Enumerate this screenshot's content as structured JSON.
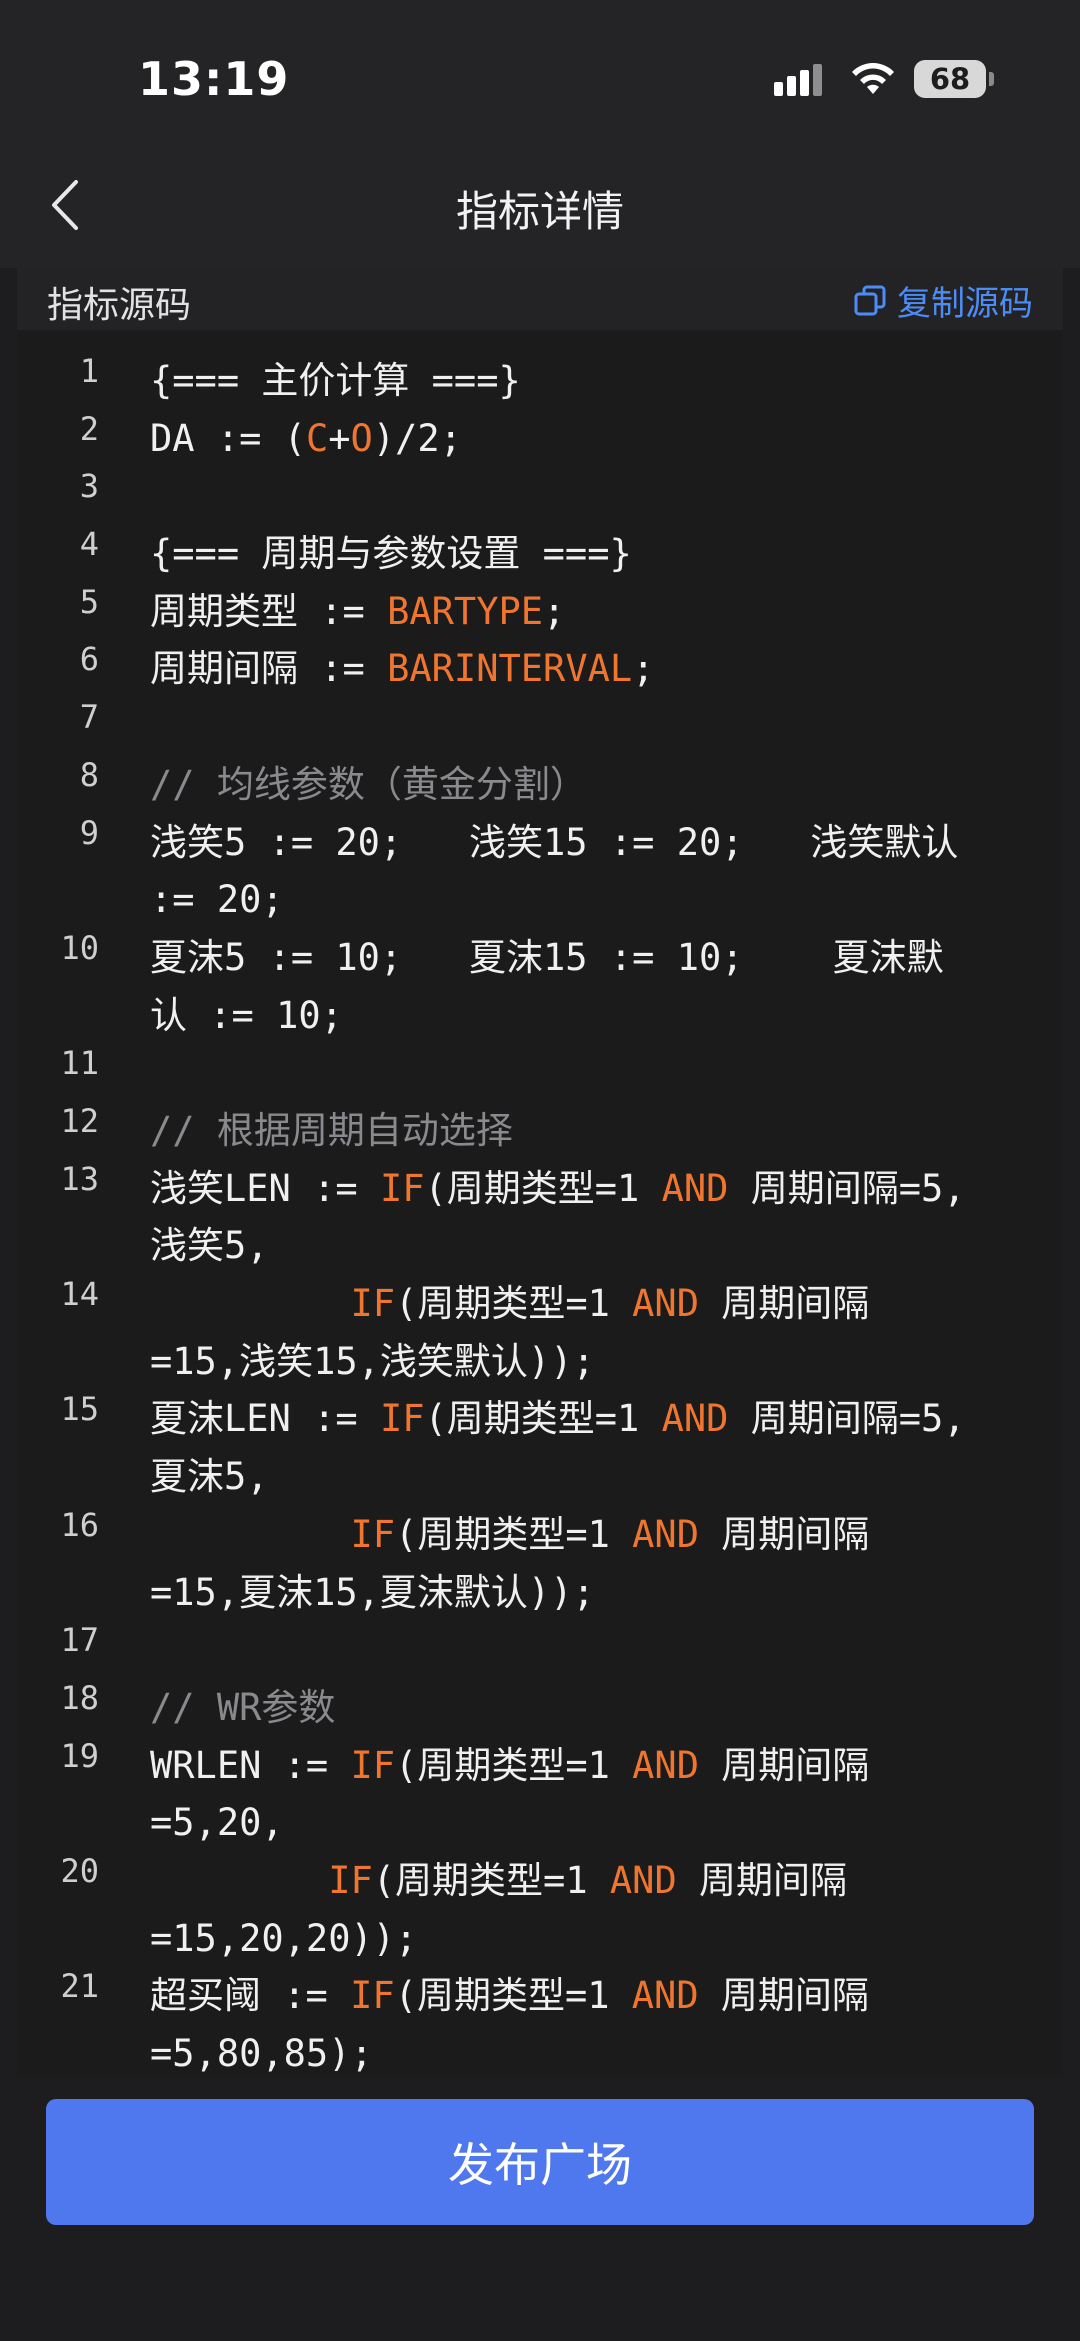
{
  "status_bar": {
    "time": "13:19",
    "battery": "68"
  },
  "header": {
    "title": "指标详情"
  },
  "card": {
    "title": "指标源码",
    "copy_label": "复制源码"
  },
  "code": [
    {
      "n": "1",
      "rows": 1,
      "parts": [
        {
          "t": "{=== 主价计算 ===}",
          "c": "txt"
        }
      ]
    },
    {
      "n": "2",
      "rows": 1,
      "parts": [
        {
          "t": "DA := (",
          "c": "txt"
        },
        {
          "t": "C",
          "c": "kw"
        },
        {
          "t": "+",
          "c": "txt"
        },
        {
          "t": "O",
          "c": "kw"
        },
        {
          "t": ")/2;",
          "c": "txt"
        }
      ]
    },
    {
      "n": "3",
      "rows": 1,
      "parts": []
    },
    {
      "n": "4",
      "rows": 1,
      "parts": [
        {
          "t": "{=== 周期与参数设置 ===}",
          "c": "txt"
        }
      ]
    },
    {
      "n": "5",
      "rows": 1,
      "parts": [
        {
          "t": "周期类型 := ",
          "c": "txt"
        },
        {
          "t": "BARTYPE",
          "c": "kw"
        },
        {
          "t": ";",
          "c": "txt"
        }
      ]
    },
    {
      "n": "6",
      "rows": 1,
      "parts": [
        {
          "t": "周期间隔 := ",
          "c": "txt"
        },
        {
          "t": "BARINTERVAL",
          "c": "kw"
        },
        {
          "t": ";",
          "c": "txt"
        }
      ]
    },
    {
      "n": "7",
      "rows": 1,
      "parts": []
    },
    {
      "n": "8",
      "rows": 1,
      "parts": [
        {
          "t": "// 均线参数（黄金分割）",
          "c": "cm"
        }
      ]
    },
    {
      "n": "9",
      "rows": 2,
      "parts": [
        {
          "t": "浅笑5 := 20;   浅笑15 := 20;   浅笑默认\n:= 20;",
          "c": "txt"
        }
      ]
    },
    {
      "n": "10",
      "rows": 2,
      "parts": [
        {
          "t": "夏沫5 := 10;   夏沫15 := 10;    夏沫默\n认 := 10;",
          "c": "txt"
        }
      ]
    },
    {
      "n": "11",
      "rows": 1,
      "parts": []
    },
    {
      "n": "12",
      "rows": 1,
      "parts": [
        {
          "t": "// 根据周期自动选择",
          "c": "cm"
        }
      ]
    },
    {
      "n": "13",
      "rows": 2,
      "parts": [
        {
          "t": "浅笑LEN := ",
          "c": "txt"
        },
        {
          "t": "IF",
          "c": "kw"
        },
        {
          "t": "(周期类型=1 ",
          "c": "txt"
        },
        {
          "t": "AND",
          "c": "kw"
        },
        {
          "t": " 周期间隔=5,\n浅笑5,",
          "c": "txt"
        }
      ]
    },
    {
      "n": "14",
      "rows": 2,
      "parts": [
        {
          "t": "         ",
          "c": "txt"
        },
        {
          "t": "IF",
          "c": "kw"
        },
        {
          "t": "(周期类型=1 ",
          "c": "txt"
        },
        {
          "t": "AND",
          "c": "kw"
        },
        {
          "t": " 周期间隔\n=15,浅笑15,浅笑默认));",
          "c": "txt"
        }
      ]
    },
    {
      "n": "15",
      "rows": 2,
      "parts": [
        {
          "t": "夏沫LEN := ",
          "c": "txt"
        },
        {
          "t": "IF",
          "c": "kw"
        },
        {
          "t": "(周期类型=1 ",
          "c": "txt"
        },
        {
          "t": "AND",
          "c": "kw"
        },
        {
          "t": " 周期间隔=5,\n夏沫5,",
          "c": "txt"
        }
      ]
    },
    {
      "n": "16",
      "rows": 2,
      "parts": [
        {
          "t": "         ",
          "c": "txt"
        },
        {
          "t": "IF",
          "c": "kw"
        },
        {
          "t": "(周期类型=1 ",
          "c": "txt"
        },
        {
          "t": "AND",
          "c": "kw"
        },
        {
          "t": " 周期间隔\n=15,夏沫15,夏沫默认));",
          "c": "txt"
        }
      ]
    },
    {
      "n": "17",
      "rows": 1,
      "parts": []
    },
    {
      "n": "18",
      "rows": 1,
      "parts": [
        {
          "t": "// WR参数",
          "c": "cm"
        }
      ]
    },
    {
      "n": "19",
      "rows": 2,
      "parts": [
        {
          "t": "WRLEN := ",
          "c": "txt"
        },
        {
          "t": "IF",
          "c": "kw"
        },
        {
          "t": "(周期类型=1 ",
          "c": "txt"
        },
        {
          "t": "AND",
          "c": "kw"
        },
        {
          "t": " 周期间隔\n=5,20,",
          "c": "txt"
        }
      ]
    },
    {
      "n": "20",
      "rows": 2,
      "parts": [
        {
          "t": "        ",
          "c": "txt"
        },
        {
          "t": "IF",
          "c": "kw"
        },
        {
          "t": "(周期类型=1 ",
          "c": "txt"
        },
        {
          "t": "AND",
          "c": "kw"
        },
        {
          "t": " 周期间隔\n=15,20,20));",
          "c": "txt"
        }
      ]
    },
    {
      "n": "21",
      "rows": 2,
      "parts": [
        {
          "t": "超买阈 := ",
          "c": "txt"
        },
        {
          "t": "IF",
          "c": "kw"
        },
        {
          "t": "(周期类型=1 ",
          "c": "txt"
        },
        {
          "t": "AND",
          "c": "kw"
        },
        {
          "t": " 周期间隔\n=5,80,85);",
          "c": "txt"
        }
      ]
    }
  ],
  "colors": {
    "keyword": "#f0762f",
    "comment": "#8a8a8e",
    "accent": "#4c8cf6",
    "button": "#5078ee"
  },
  "footer": {
    "publish_label": "发布广场"
  }
}
